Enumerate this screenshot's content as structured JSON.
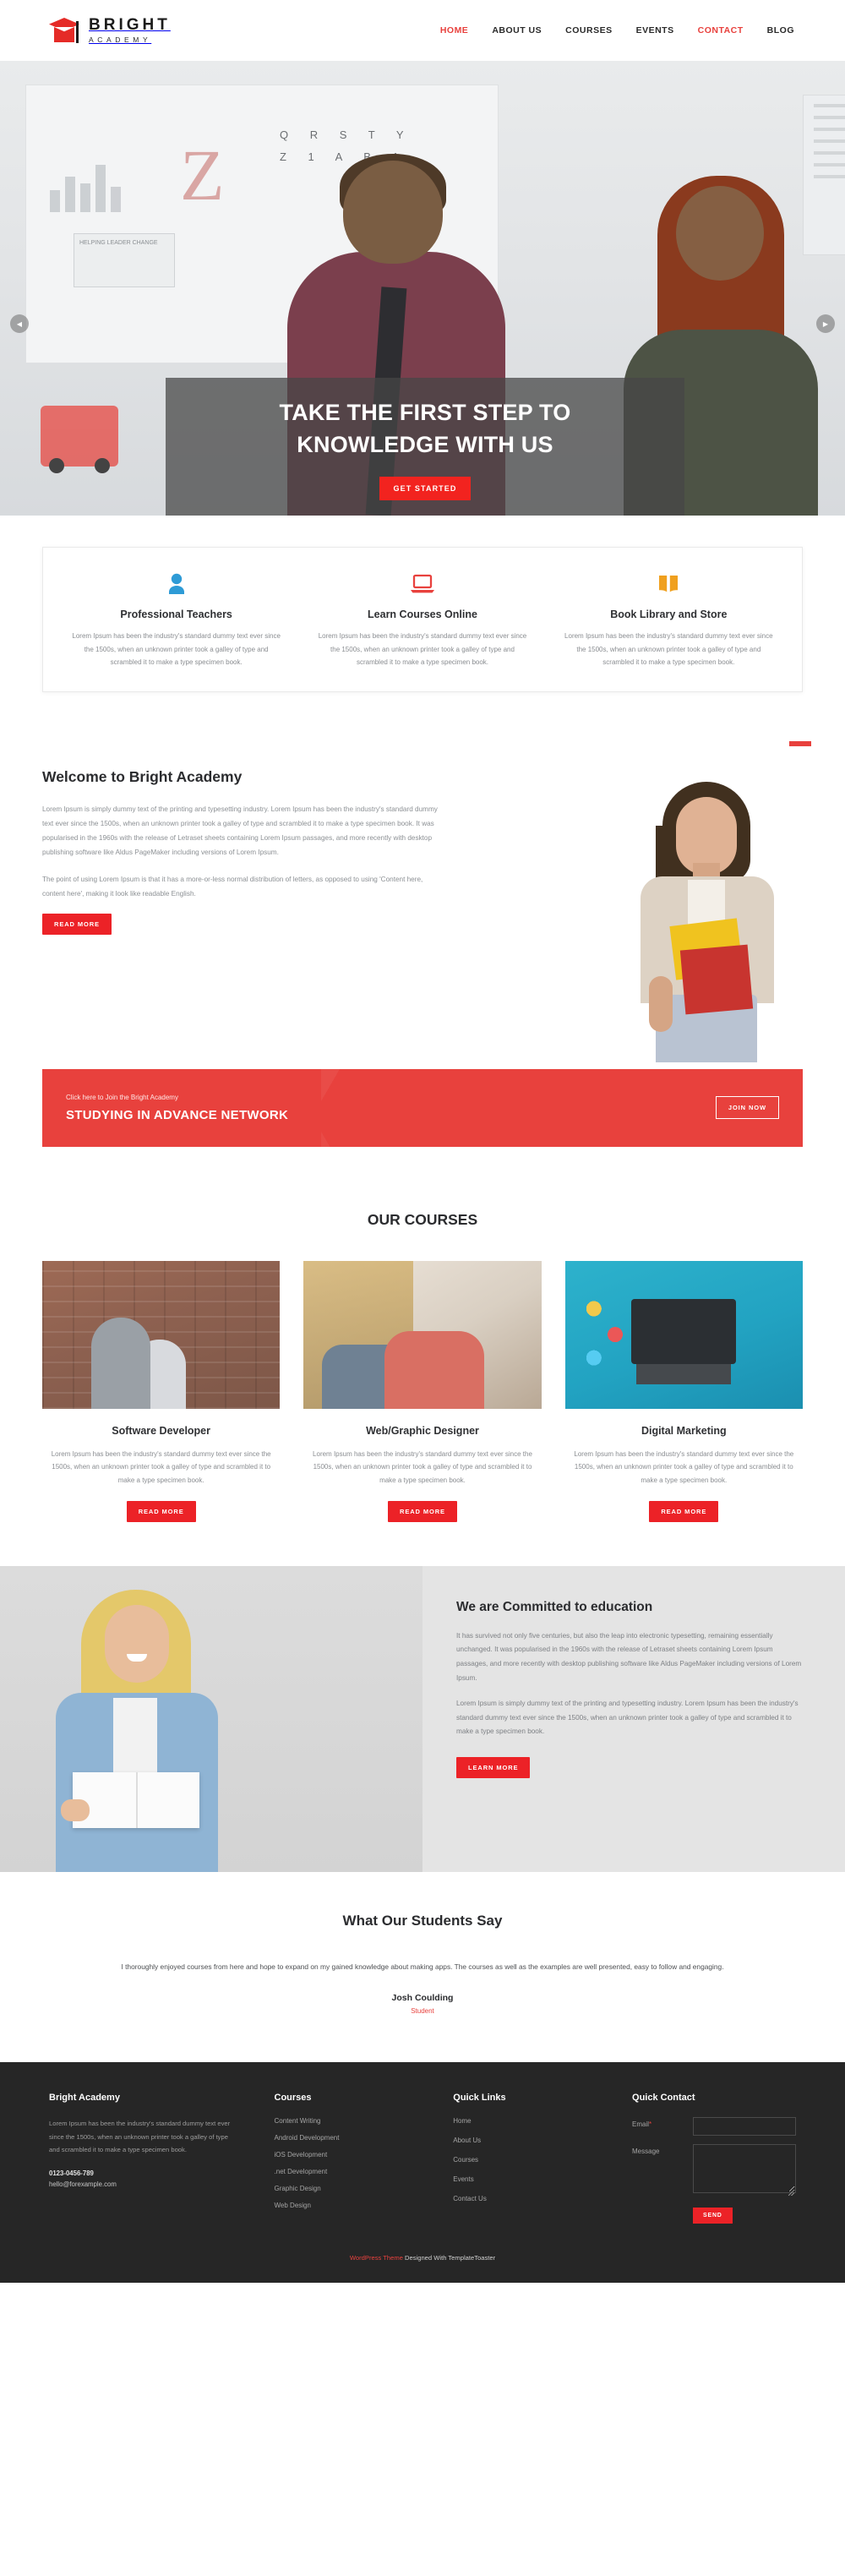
{
  "brand": {
    "name_line1": "BRIGHT",
    "name_line2": "ACADEMY",
    "accent_color": "#e8413d",
    "button_red": "#ec2227"
  },
  "nav": {
    "items": [
      {
        "label": "HOME",
        "active": true
      },
      {
        "label": "ABOUT US",
        "active": false
      },
      {
        "label": "COURSES",
        "active": false
      },
      {
        "label": "EVENTS",
        "active": false
      },
      {
        "label": "CONTACT",
        "active": true
      },
      {
        "label": "BLOG",
        "active": false
      }
    ]
  },
  "hero": {
    "title_line1": "TAKE THE FIRST STEP TO",
    "title_line2": "KNOWLEDGE WITH US",
    "cta": "GET STARTED",
    "prev_icon": "chevron-left-icon",
    "next_icon": "chevron-right-icon",
    "whiteboard_letter": "Z",
    "whiteboard_grid": "Q R S T Y Z 1 A B 1",
    "whiteboard_note": "HELPING LEADER CHANGE"
  },
  "features": [
    {
      "icon": "user-icon",
      "icon_color": "#2e9bd6",
      "title": "Professional Teachers",
      "text": "Lorem Ipsum has been the industry's standard dummy text ever since the 1500s, when an unknown printer took a galley of type and scrambled it to make a type specimen book."
    },
    {
      "icon": "laptop-icon",
      "icon_color": "#e8413d",
      "title": "Learn Courses Online",
      "text": "Lorem Ipsum has been the industry's standard dummy text ever since the 1500s, when an unknown printer took a galley of type and scrambled it to make a type specimen book."
    },
    {
      "icon": "open-book-icon",
      "icon_color": "#f0a01e",
      "title": "Book Library and Store",
      "text": "Lorem Ipsum has been the industry's standard dummy text ever since the 1500s, when an unknown printer took a galley of type and scrambled it to make a type specimen book."
    }
  ],
  "welcome": {
    "title": "Welcome to Bright Academy",
    "paragraph1": "Lorem Ipsum is simply dummy text of the printing and typesetting industry. Lorem Ipsum has been the industry's standard dummy text ever since the 1500s, when an unknown printer took a galley of type and scrambled it to make a type specimen book. It was popularised in the 1960s with the release of Letraset sheets containing Lorem Ipsum passages, and more recently with desktop publishing software like Aldus PageMaker including versions of Lorem Ipsum.",
    "paragraph2": "The point of using Lorem Ipsum is that it has a more-or-less normal distribution of letters, as opposed to using 'Content here, content here', making it look like readable English.",
    "cta": "READ MORE"
  },
  "join": {
    "subtitle": "Click here to Join the Bright Academy",
    "title": "STUDYING IN ADVANCE NETWORK",
    "cta": "JOIN NOW"
  },
  "courses": {
    "title": "OUR COURSES",
    "items": [
      {
        "image": "man-at-computer-photo",
        "title": "Software Developer",
        "text": "Lorem Ipsum has been the industry's standard dummy text ever since the 1500s, when an unknown printer took a galley of type and scrambled it to make a type specimen book.",
        "cta": "READ MORE"
      },
      {
        "image": "team-at-desk-photo",
        "title": "Web/Graphic Designer",
        "text": "Lorem Ipsum has been the industry's standard dummy text ever since the 1500s, when an unknown printer took a galley of type and scrambled it to make a type specimen book.",
        "cta": "READ MORE"
      },
      {
        "image": "laptop-with-app-icons-photo",
        "title": "Digital Marketing",
        "text": "Lorem Ipsum has been the industry's standard dummy text ever since the 1500s, when an unknown printer took a galley of type and scrambled it to make a type specimen book.",
        "cta": "READ MORE"
      }
    ]
  },
  "committed": {
    "image": "woman-reading-book-photo",
    "title": "We are Committed to education",
    "paragraph1": "It has survived not only five centuries, but also the leap into electronic typesetting, remaining essentially unchanged. It was popularised in the 1960s with the release of Letraset sheets containing Lorem Ipsum passages, and more recently with desktop publishing software like Aldus PageMaker including versions of Lorem Ipsum.",
    "paragraph2": "Lorem Ipsum is simply dummy text of the printing and typesetting industry. Lorem Ipsum has been the industry's standard dummy text ever since the 1500s, when an unknown printer took a galley of type and scrambled it to make a type specimen book.",
    "cta": "LEARN MORE"
  },
  "testimonials": {
    "title": "What Our Students Say",
    "quote": "I thoroughly enjoyed courses from here and hope to expand on my gained knowledge about making apps. The courses as well as the examples are well presented, easy to follow and engaging.",
    "author": "Josh Coulding",
    "role": "Student"
  },
  "footer": {
    "about": {
      "title": "Bright Academy",
      "text": "Lorem Ipsum has been the industry's standard dummy text ever since the 1500s, when an unknown printer took a galley of type and scrambled it to make a type specimen book.",
      "phone": "0123-0456-789",
      "email": "hello@forexample.com"
    },
    "courses": {
      "title": "Courses",
      "links": [
        "Content Writing",
        "Android Development",
        "iOS Development",
        ".net Development",
        "Graphic Design",
        "Web Design"
      ]
    },
    "quick_links": {
      "title": "Quick Links",
      "links": [
        "Home",
        "About Us",
        "Courses",
        "Events",
        "Contact Us"
      ]
    },
    "contact": {
      "title": "Quick Contact",
      "email_label": "Email",
      "email_required_mark": "*",
      "email_value": "",
      "message_label": "Message",
      "message_value": "",
      "send_label": "SEND"
    },
    "bottom": {
      "link_text": "WordPress Theme",
      "text": " Designed With TemplateToaster"
    }
  }
}
